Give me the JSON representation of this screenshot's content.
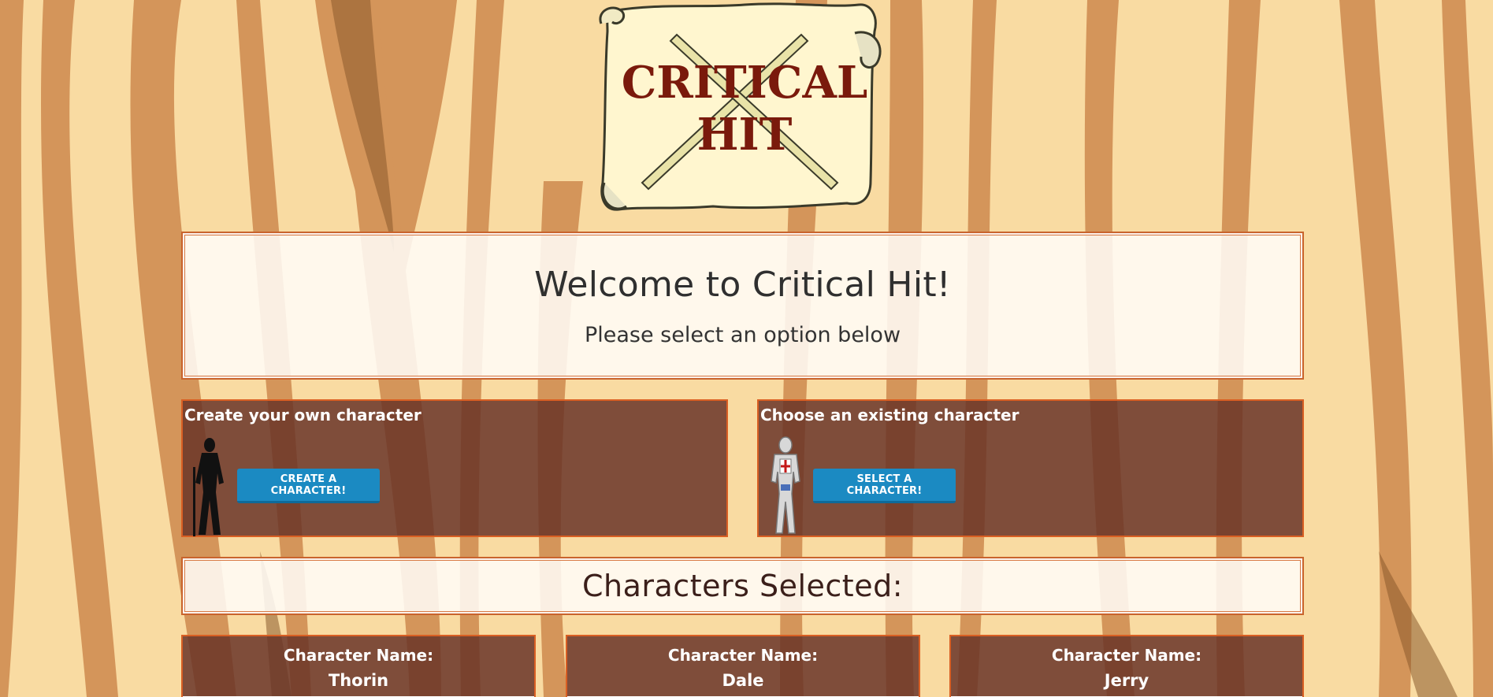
{
  "logo": {
    "line1": "CRITICAL",
    "line2": "HIT"
  },
  "welcome": {
    "title": "Welcome to Critical Hit!",
    "subtitle": "Please select an option below"
  },
  "options": {
    "create": {
      "heading": "Create your own character",
      "button_label": "CREATE A CHARACTER!",
      "figure_icon": "warrior-silhouette-icon"
    },
    "choose": {
      "heading": "Choose an existing character",
      "button_label": "SELECT A CHARACTER!",
      "figure_icon": "armored-knight-icon"
    }
  },
  "selected": {
    "title": "Characters Selected:"
  },
  "characters": [
    {
      "label": "Character Name:",
      "name": "Thorin"
    },
    {
      "label": "Character Name:",
      "name": "Dale"
    },
    {
      "label": "Character Name:",
      "name": "Jerry"
    }
  ],
  "colors": {
    "background": "#f9dba2",
    "wood_stripe": "#d4955a",
    "panel_dark": "#683226",
    "panel_border": "#d95f23",
    "button": "#1b8ac2",
    "logo_text": "#7a1a0c"
  }
}
